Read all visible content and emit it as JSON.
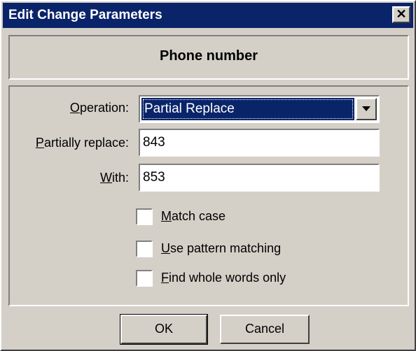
{
  "window": {
    "title": "Edit Change Parameters",
    "close_glyph": "✕"
  },
  "record": {
    "title": "Phone number"
  },
  "fields": {
    "operation": {
      "label_prefix": "",
      "label_accel": "O",
      "label_rest": "peration:",
      "value": "Partial Replace"
    },
    "partially_replace": {
      "label_accel": "P",
      "label_rest": "artially replace:",
      "value": "843"
    },
    "with": {
      "label_accel": "W",
      "label_rest": "ith:",
      "value": "853"
    }
  },
  "options": [
    {
      "accel": "M",
      "rest": "atch case",
      "checked": false
    },
    {
      "accel": "U",
      "rest": "se pattern matching",
      "checked": false
    },
    {
      "accel": "F",
      "rest": "ind whole words only",
      "checked": false
    }
  ],
  "buttons": {
    "ok": "OK",
    "cancel": "Cancel"
  },
  "colors": {
    "title_bar": "#0a246a",
    "face": "#d4d0c8",
    "selection": "#0a246a"
  }
}
